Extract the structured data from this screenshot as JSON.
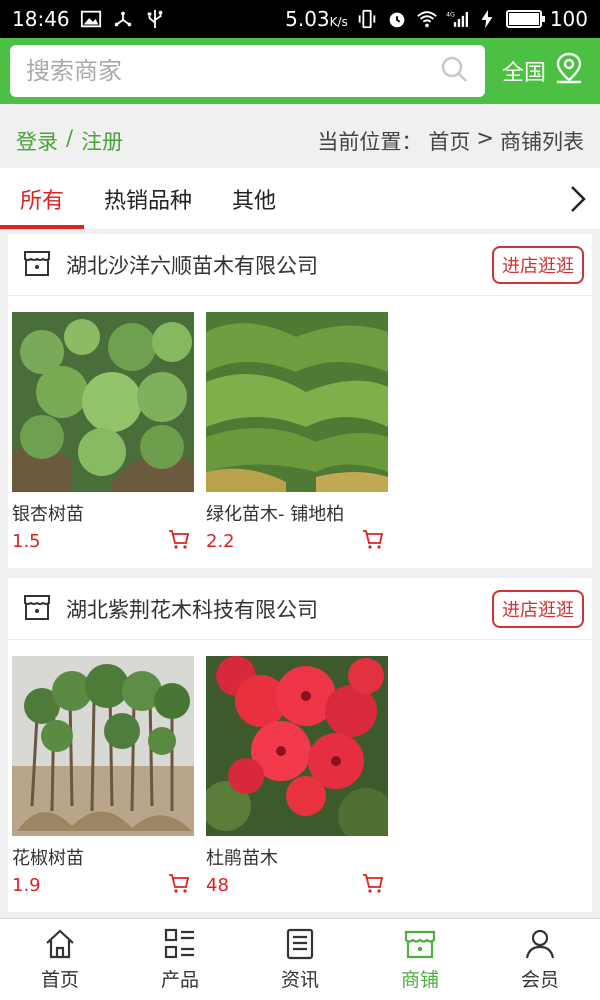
{
  "status_bar": {
    "time": "18:46",
    "speed": "5.03",
    "speed_unit": "K/s",
    "network_label": "4G",
    "battery": "100",
    "battery_level": 1.0
  },
  "search": {
    "placeholder": "搜索商家",
    "region_label": "全国"
  },
  "auth": {
    "login": "登录",
    "separator": "/",
    "register": "注册"
  },
  "breadcrumb": {
    "prefix": "当前位置：",
    "home": "首页",
    "arrow": ">",
    "current": "商铺列表"
  },
  "tabs": [
    {
      "label": "所有",
      "active": true
    },
    {
      "label": "热销品种",
      "active": false
    },
    {
      "label": "其他",
      "active": false
    }
  ],
  "shops": [
    {
      "name": "湖北沙洋六顺苗木有限公司",
      "enter_label": "进店逛逛",
      "products": [
        {
          "name": "银杏树苗",
          "price": "1.5"
        },
        {
          "name": "绿化苗木- 铺地柏",
          "price": "2.2"
        }
      ]
    },
    {
      "name": "湖北紫荆花木科技有限公司",
      "enter_label": "进店逛逛",
      "products": [
        {
          "name": "花椒树苗",
          "price": "1.9"
        },
        {
          "name": "杜鹃苗木",
          "price": "48"
        }
      ]
    }
  ],
  "bottom_nav": [
    {
      "label": "首页",
      "icon": "home-icon"
    },
    {
      "label": "产品",
      "icon": "list-icon"
    },
    {
      "label": "资讯",
      "icon": "news-icon"
    },
    {
      "label": "商铺",
      "icon": "store-icon",
      "active": true
    },
    {
      "label": "会员",
      "icon": "user-icon"
    }
  ],
  "colors": {
    "accent_green": "#4cc042",
    "active_red": "#dd2222",
    "price_red": "#dd2222"
  }
}
